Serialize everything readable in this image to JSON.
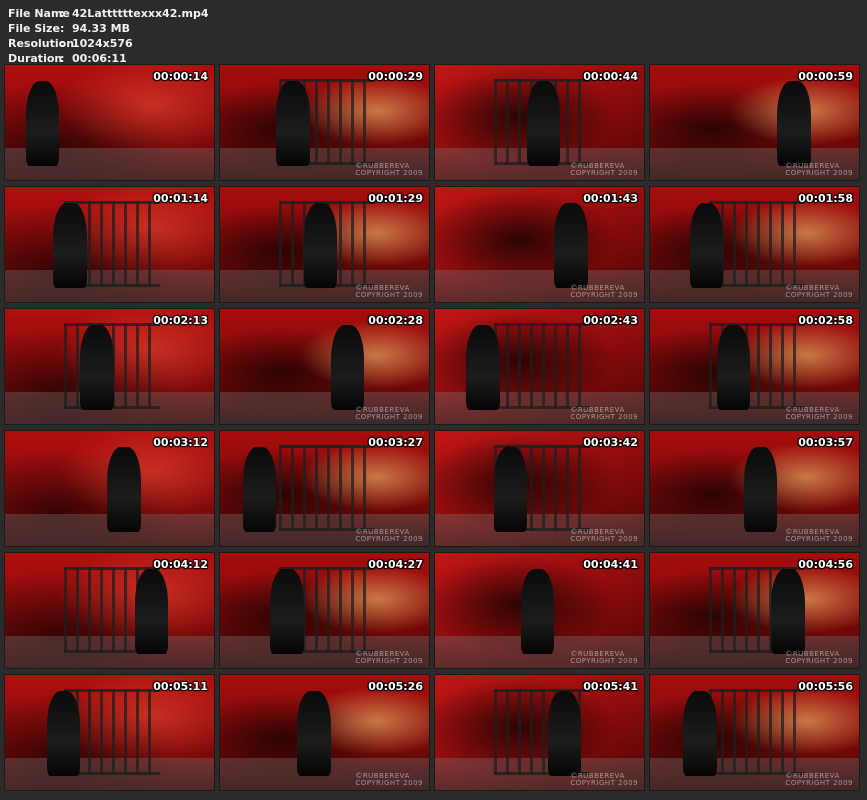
{
  "file_info": {
    "rows": [
      {
        "label": "File Name",
        "value": "42Lattttttexxx42.mp4"
      },
      {
        "label": "File Size",
        "value": "94.33 MB"
      },
      {
        "label": "Resolution",
        "value": "1024x576"
      },
      {
        "label": "Duration",
        "value": "00:06:11"
      }
    ],
    "separator": ":"
  },
  "watermark": {
    "line1": "©RUBBEREVA",
    "line2": "COPYRIGHT 2009"
  },
  "thumbnails": [
    {
      "timestamp": "00:00:14",
      "watermark": false
    },
    {
      "timestamp": "00:00:29",
      "watermark": true
    },
    {
      "timestamp": "00:00:44",
      "watermark": true
    },
    {
      "timestamp": "00:00:59",
      "watermark": true
    },
    {
      "timestamp": "00:01:14",
      "watermark": false
    },
    {
      "timestamp": "00:01:29",
      "watermark": true
    },
    {
      "timestamp": "00:01:43",
      "watermark": true
    },
    {
      "timestamp": "00:01:58",
      "watermark": true
    },
    {
      "timestamp": "00:02:13",
      "watermark": false
    },
    {
      "timestamp": "00:02:28",
      "watermark": true
    },
    {
      "timestamp": "00:02:43",
      "watermark": true
    },
    {
      "timestamp": "00:02:58",
      "watermark": true
    },
    {
      "timestamp": "00:03:12",
      "watermark": false
    },
    {
      "timestamp": "00:03:27",
      "watermark": true
    },
    {
      "timestamp": "00:03:42",
      "watermark": true
    },
    {
      "timestamp": "00:03:57",
      "watermark": true
    },
    {
      "timestamp": "00:04:12",
      "watermark": false
    },
    {
      "timestamp": "00:04:27",
      "watermark": true
    },
    {
      "timestamp": "00:04:41",
      "watermark": true
    },
    {
      "timestamp": "00:04:56",
      "watermark": true
    },
    {
      "timestamp": "00:05:11",
      "watermark": false
    },
    {
      "timestamp": "00:05:26",
      "watermark": true
    },
    {
      "timestamp": "00:05:41",
      "watermark": true
    },
    {
      "timestamp": "00:05:56",
      "watermark": true
    }
  ],
  "colors": {
    "background": "#2b2b2b",
    "text": "#f2f2f2",
    "scene_red": "#b10f0f"
  }
}
